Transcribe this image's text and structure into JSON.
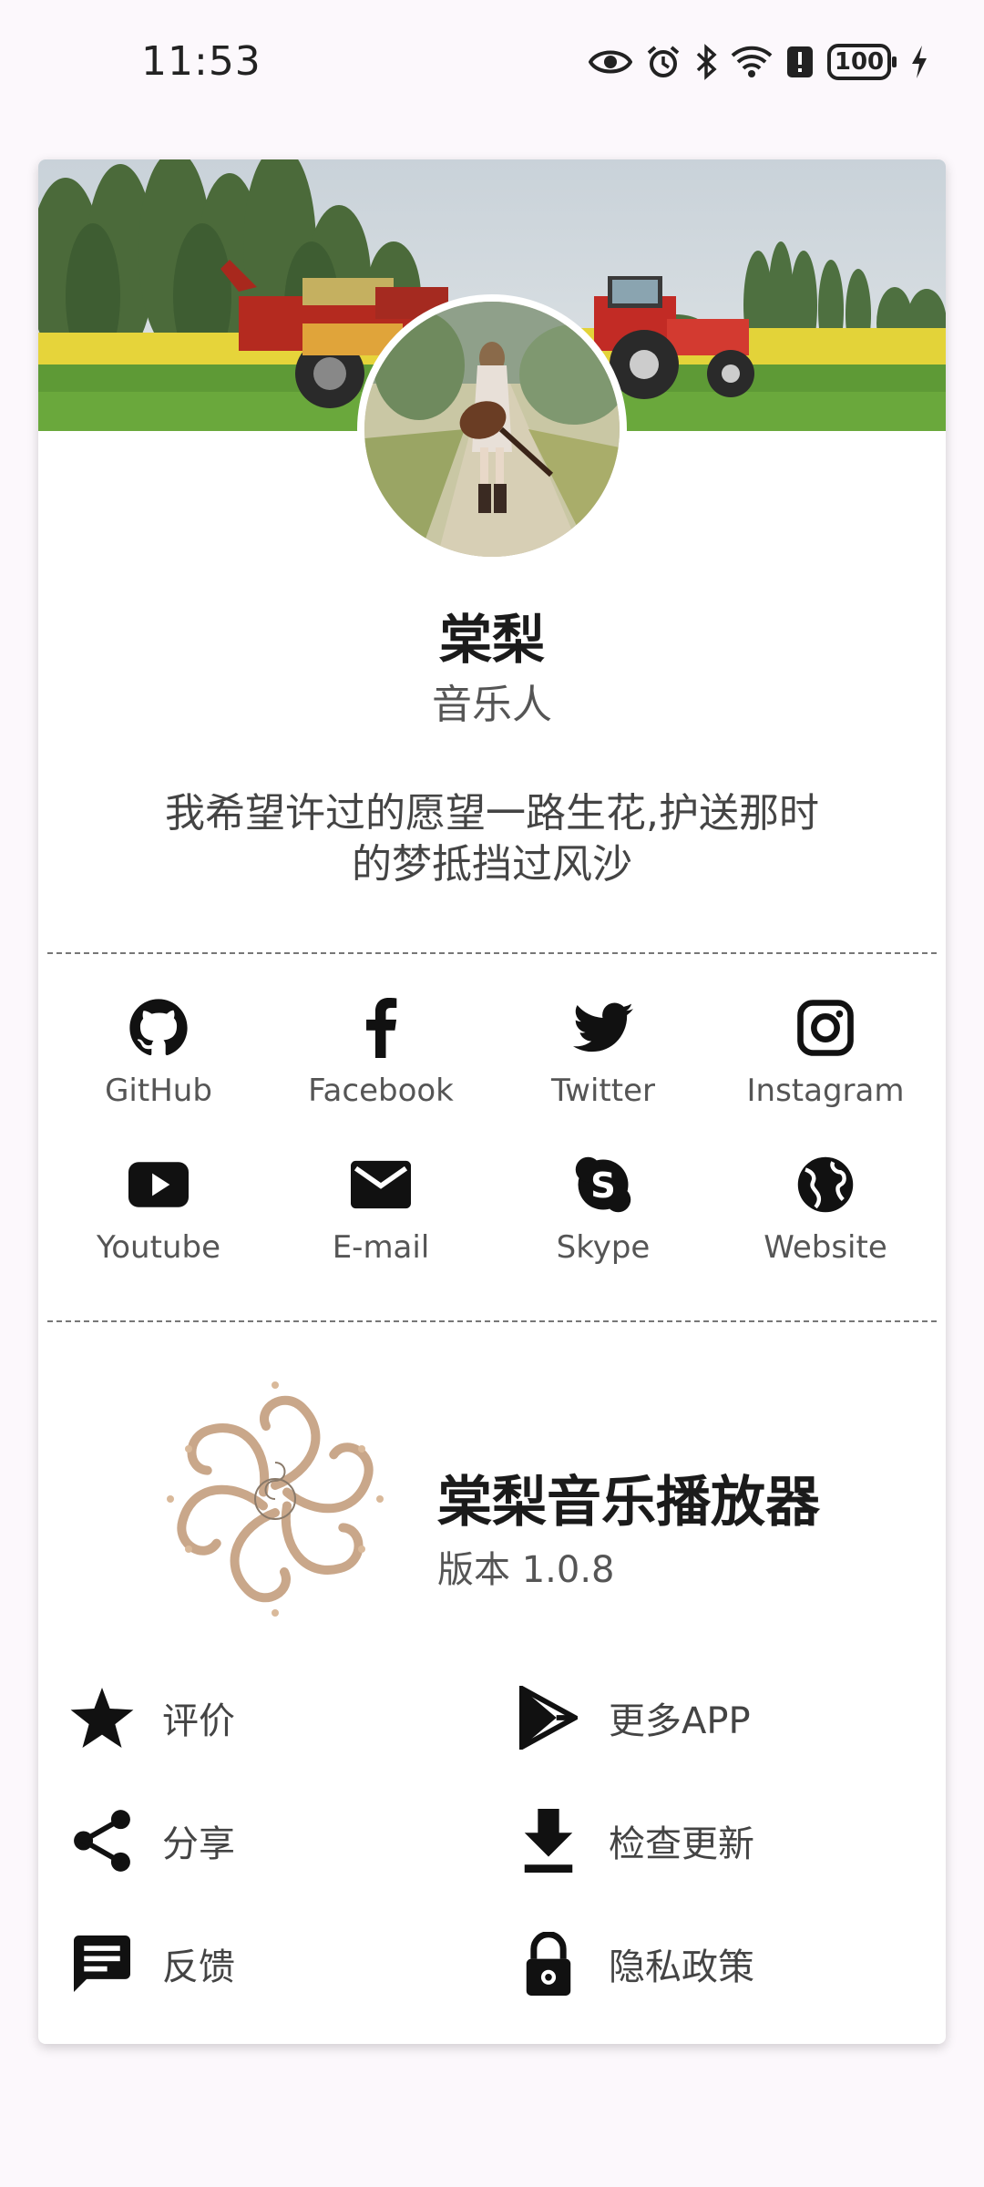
{
  "status_bar": {
    "time": "11:53",
    "battery": "100",
    "icons": [
      "eye-icon",
      "alarm-icon",
      "bluetooth-icon",
      "wifi-icon",
      "alert-icon",
      "battery-icon",
      "charging-icon"
    ]
  },
  "profile": {
    "name": "棠梨",
    "role": "音乐人",
    "motto": "我希望许过的愿望一路生花,护送那时的梦抵挡过风沙"
  },
  "social": [
    {
      "label": "GitHub",
      "icon": "github-icon"
    },
    {
      "label": "Facebook",
      "icon": "facebook-icon"
    },
    {
      "label": "Twitter",
      "icon": "twitter-icon"
    },
    {
      "label": "Instagram",
      "icon": "instagram-icon"
    },
    {
      "label": "Youtube",
      "icon": "youtube-icon"
    },
    {
      "label": "E-mail",
      "icon": "email-icon"
    },
    {
      "label": "Skype",
      "icon": "skype-icon"
    },
    {
      "label": "Website",
      "icon": "globe-icon"
    }
  ],
  "app": {
    "title": "棠梨音乐播放器",
    "version": "版本 1.0.8"
  },
  "actions": [
    {
      "label": "评价",
      "icon": "star-icon"
    },
    {
      "label": "更多APP",
      "icon": "play-store-icon"
    },
    {
      "label": "分享",
      "icon": "share-icon"
    },
    {
      "label": "检查更新",
      "icon": "download-icon"
    },
    {
      "label": "反馈",
      "icon": "feedback-icon"
    },
    {
      "label": "隐私政策",
      "icon": "lock-icon"
    }
  ]
}
